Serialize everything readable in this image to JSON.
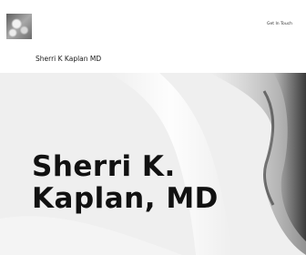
{
  "header": {
    "logo_icon": "abstract-texture-logo-icon",
    "nav": {
      "get_in_touch": "Get In Touch"
    },
    "site_title": "Sherri K Kaplan MD"
  },
  "hero": {
    "background": "abstract-white-fabric-folds",
    "heading": "Sherri K. Kaplan, MD"
  }
}
